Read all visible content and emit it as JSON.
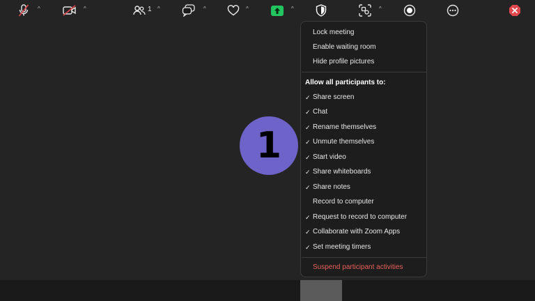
{
  "avatar": {
    "initial": "1",
    "color": "#6e63c9"
  },
  "security_menu": {
    "items_top": [
      {
        "label": "Lock meeting"
      },
      {
        "label": "Enable waiting room"
      },
      {
        "label": "Hide profile pictures"
      }
    ],
    "section_header": "Allow all participants to:",
    "permissions": [
      {
        "label": "Share screen",
        "checked": true
      },
      {
        "label": "Chat",
        "checked": true
      },
      {
        "label": "Rename themselves",
        "checked": true
      },
      {
        "label": "Unmute themselves",
        "checked": true
      },
      {
        "label": "Start video",
        "checked": true
      },
      {
        "label": "Share whiteboards",
        "checked": true
      },
      {
        "label": "Share notes",
        "checked": true
      },
      {
        "label": "Record to computer",
        "checked": false
      },
      {
        "label": "Request to record to computer",
        "checked": true
      },
      {
        "label": "Collaborate with Zoom Apps",
        "checked": true
      },
      {
        "label": "Set meeting timers",
        "checked": true
      }
    ],
    "suspend_label": "Suspend participant activities",
    "check_glyph": "✓"
  },
  "toolbar": {
    "participants_count": "1",
    "caret_glyph": "^",
    "icons": {
      "mic": "microphone-muted-icon",
      "video": "video-off-icon",
      "participants": "participants-icon",
      "chat": "chat-icon",
      "reactions": "heart-icon",
      "share": "share-screen-icon",
      "security": "shield-icon",
      "apps": "apps-icon",
      "record": "record-icon",
      "more": "more-icon",
      "end": "end-meeting-icon"
    },
    "colors": {
      "share_green": "#22c55e",
      "danger_red": "#e8615a",
      "muted_red": "#e0484d"
    }
  }
}
